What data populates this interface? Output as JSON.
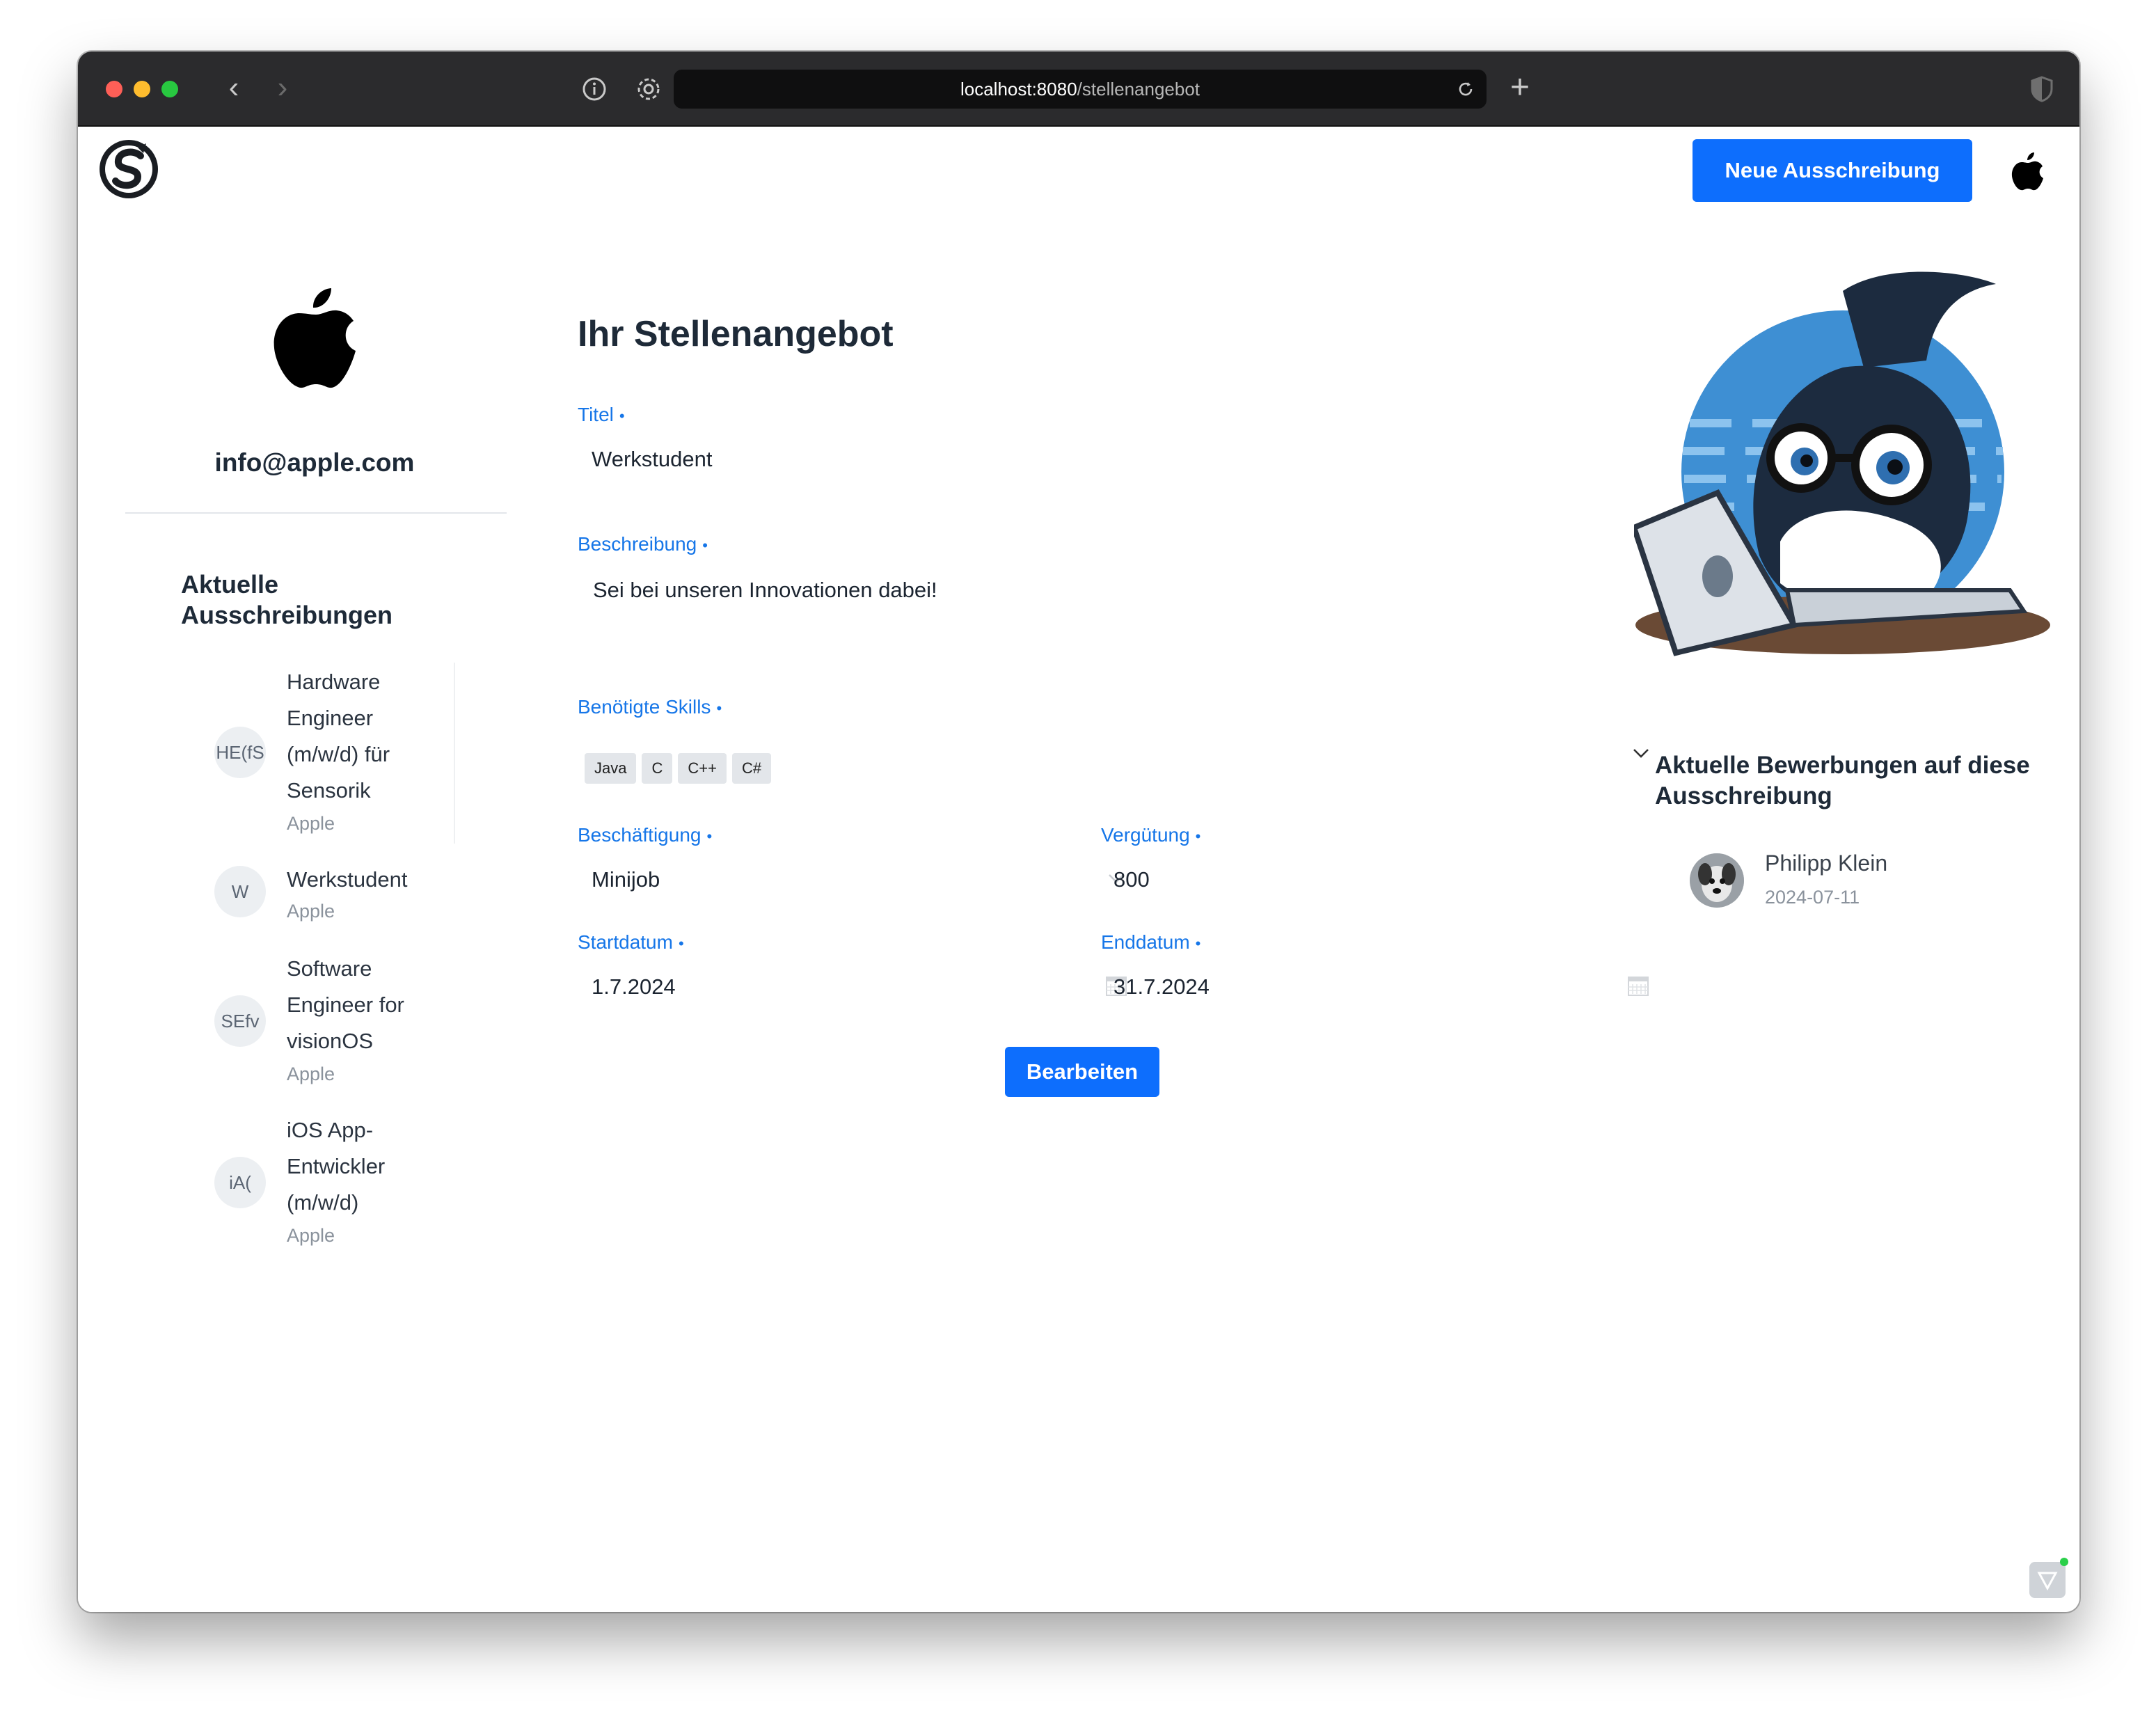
{
  "browser": {
    "url_host": "localhost:8080",
    "url_path": "/stellenangebot"
  },
  "header": {
    "new_button": "Neue Ausschreibung"
  },
  "company": {
    "email": "info@apple.com"
  },
  "sidebar": {
    "heading": "Aktuelle Ausschreibungen",
    "jobs": [
      {
        "initials": "HE(fS",
        "title": "Hardware Engineer (m/w/d) für Sensorik",
        "company": "Apple"
      },
      {
        "initials": "W",
        "title": "Werkstudent",
        "company": "Apple"
      },
      {
        "initials": "SEfv",
        "title": "Software Engineer for visionOS",
        "company": "Apple"
      },
      {
        "initials": "iA(",
        "title": "iOS App-Entwickler (m/w/d)",
        "company": "Apple"
      }
    ]
  },
  "form": {
    "page_title": "Ihr Stellenangebot",
    "titel_label": "Titel",
    "titel_value": "Werkstudent",
    "beschreibung_label": "Beschreibung",
    "beschreibung_value": "Sei bei unseren Innovationen dabei!",
    "skills_label": "Benötigte Skills",
    "skills": [
      "Java",
      "C",
      "C++",
      "C#"
    ],
    "beschaeftigung_label": "Beschäftigung",
    "beschaeftigung_value": "Minijob",
    "verguetung_label": "Vergütung",
    "verguetung_value": "800",
    "startdatum_label": "Startdatum",
    "startdatum_value": "1.7.2024",
    "enddatum_label": "Enddatum",
    "enddatum_value": "31.7.2024",
    "required_marker": "•",
    "edit_button": "Bearbeiten"
  },
  "applications": {
    "heading": "Aktuelle Bewerbungen auf diese Ausschreibung",
    "items": [
      {
        "name": "Philipp Klein",
        "date": "2024-07-11"
      }
    ]
  },
  "colors": {
    "accent": "#0d6efd",
    "label": "#1676e8"
  }
}
